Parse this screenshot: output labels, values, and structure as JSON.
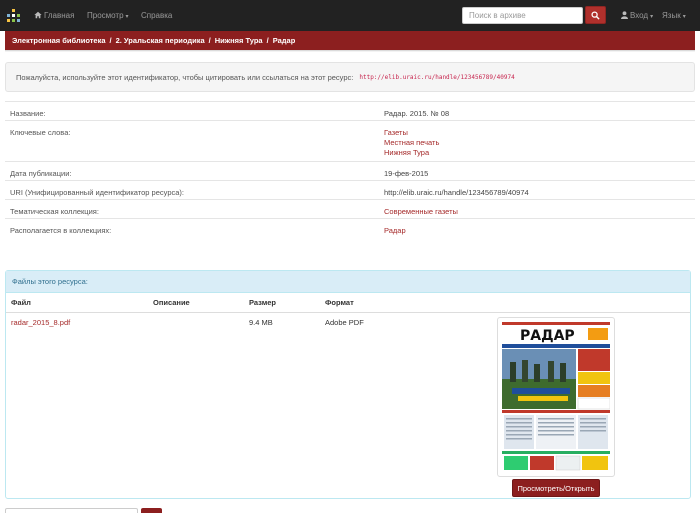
{
  "navbar": {
    "home": "Главная",
    "browse": "Просмотр",
    "help": "Справка",
    "search_placeholder": "Поиск в архиве",
    "login": "Вход",
    "language": "Язык",
    "accent": "#b0302c"
  },
  "breadcrumb": [
    "Электронная библиотека",
    "2. Уральская периодика",
    "Нижняя Тура",
    "Радар"
  ],
  "citation": {
    "text": "Пожалуйста, используйте этот идентификатор, чтобы цитировать или ссылаться на этот ресурс:",
    "uri": "http://elib.uraic.ru/handle/123456789/40974"
  },
  "metadata": [
    {
      "label": "Название:",
      "values": [
        "Радар. 2015. № 08"
      ],
      "links": false
    },
    {
      "label": "Ключевые слова:",
      "values": [
        "Газеты",
        "Местная печать",
        "Нижняя Тура"
      ],
      "links": true
    },
    {
      "label": "Дата публикации:",
      "values": [
        "19-фев-2015"
      ],
      "links": false
    },
    {
      "label": "URI (Унифицированный идентификатор ресурса):",
      "values": [
        "http://elib.uraic.ru/handle/123456789/40974"
      ],
      "links": false
    },
    {
      "label": "Тематическая коллекция:",
      "values": [
        "Современные газеты"
      ],
      "links": true
    },
    {
      "label": "Располагается в коллекциях:",
      "values": [
        "Радар"
      ],
      "links": true
    }
  ],
  "files": {
    "heading": "Файлы этого ресурса:",
    "columns": {
      "file": "Файл",
      "description": "Описание",
      "size": "Размер",
      "format": "Формат"
    },
    "rows": [
      {
        "file": "radar_2015_8.pdf",
        "description": "",
        "size": "9.4 MB",
        "format": "Adobe PDF"
      }
    ],
    "thumbnail": {
      "masthead": "РАДАР"
    },
    "open_button": "Просмотреть/Открыть"
  }
}
